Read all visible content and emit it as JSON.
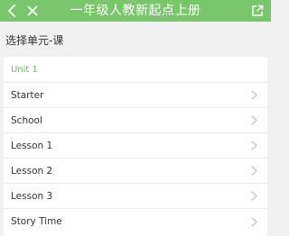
{
  "header": {
    "title": "一年级人教新起点上册",
    "back_icon": "chevron-left-icon",
    "close_icon": "close-icon",
    "share_icon": "share-icon",
    "bg_color": "#79c66d"
  },
  "section_title": "选择单元-课",
  "unit": {
    "label": "Unit 1",
    "accent_color": "#63bd57"
  },
  "lessons": [
    {
      "label": "Starter"
    },
    {
      "label": "School"
    },
    {
      "label": "Lesson 1"
    },
    {
      "label": "Lesson 2"
    },
    {
      "label": "Lesson 3"
    },
    {
      "label": "Story Time"
    }
  ]
}
